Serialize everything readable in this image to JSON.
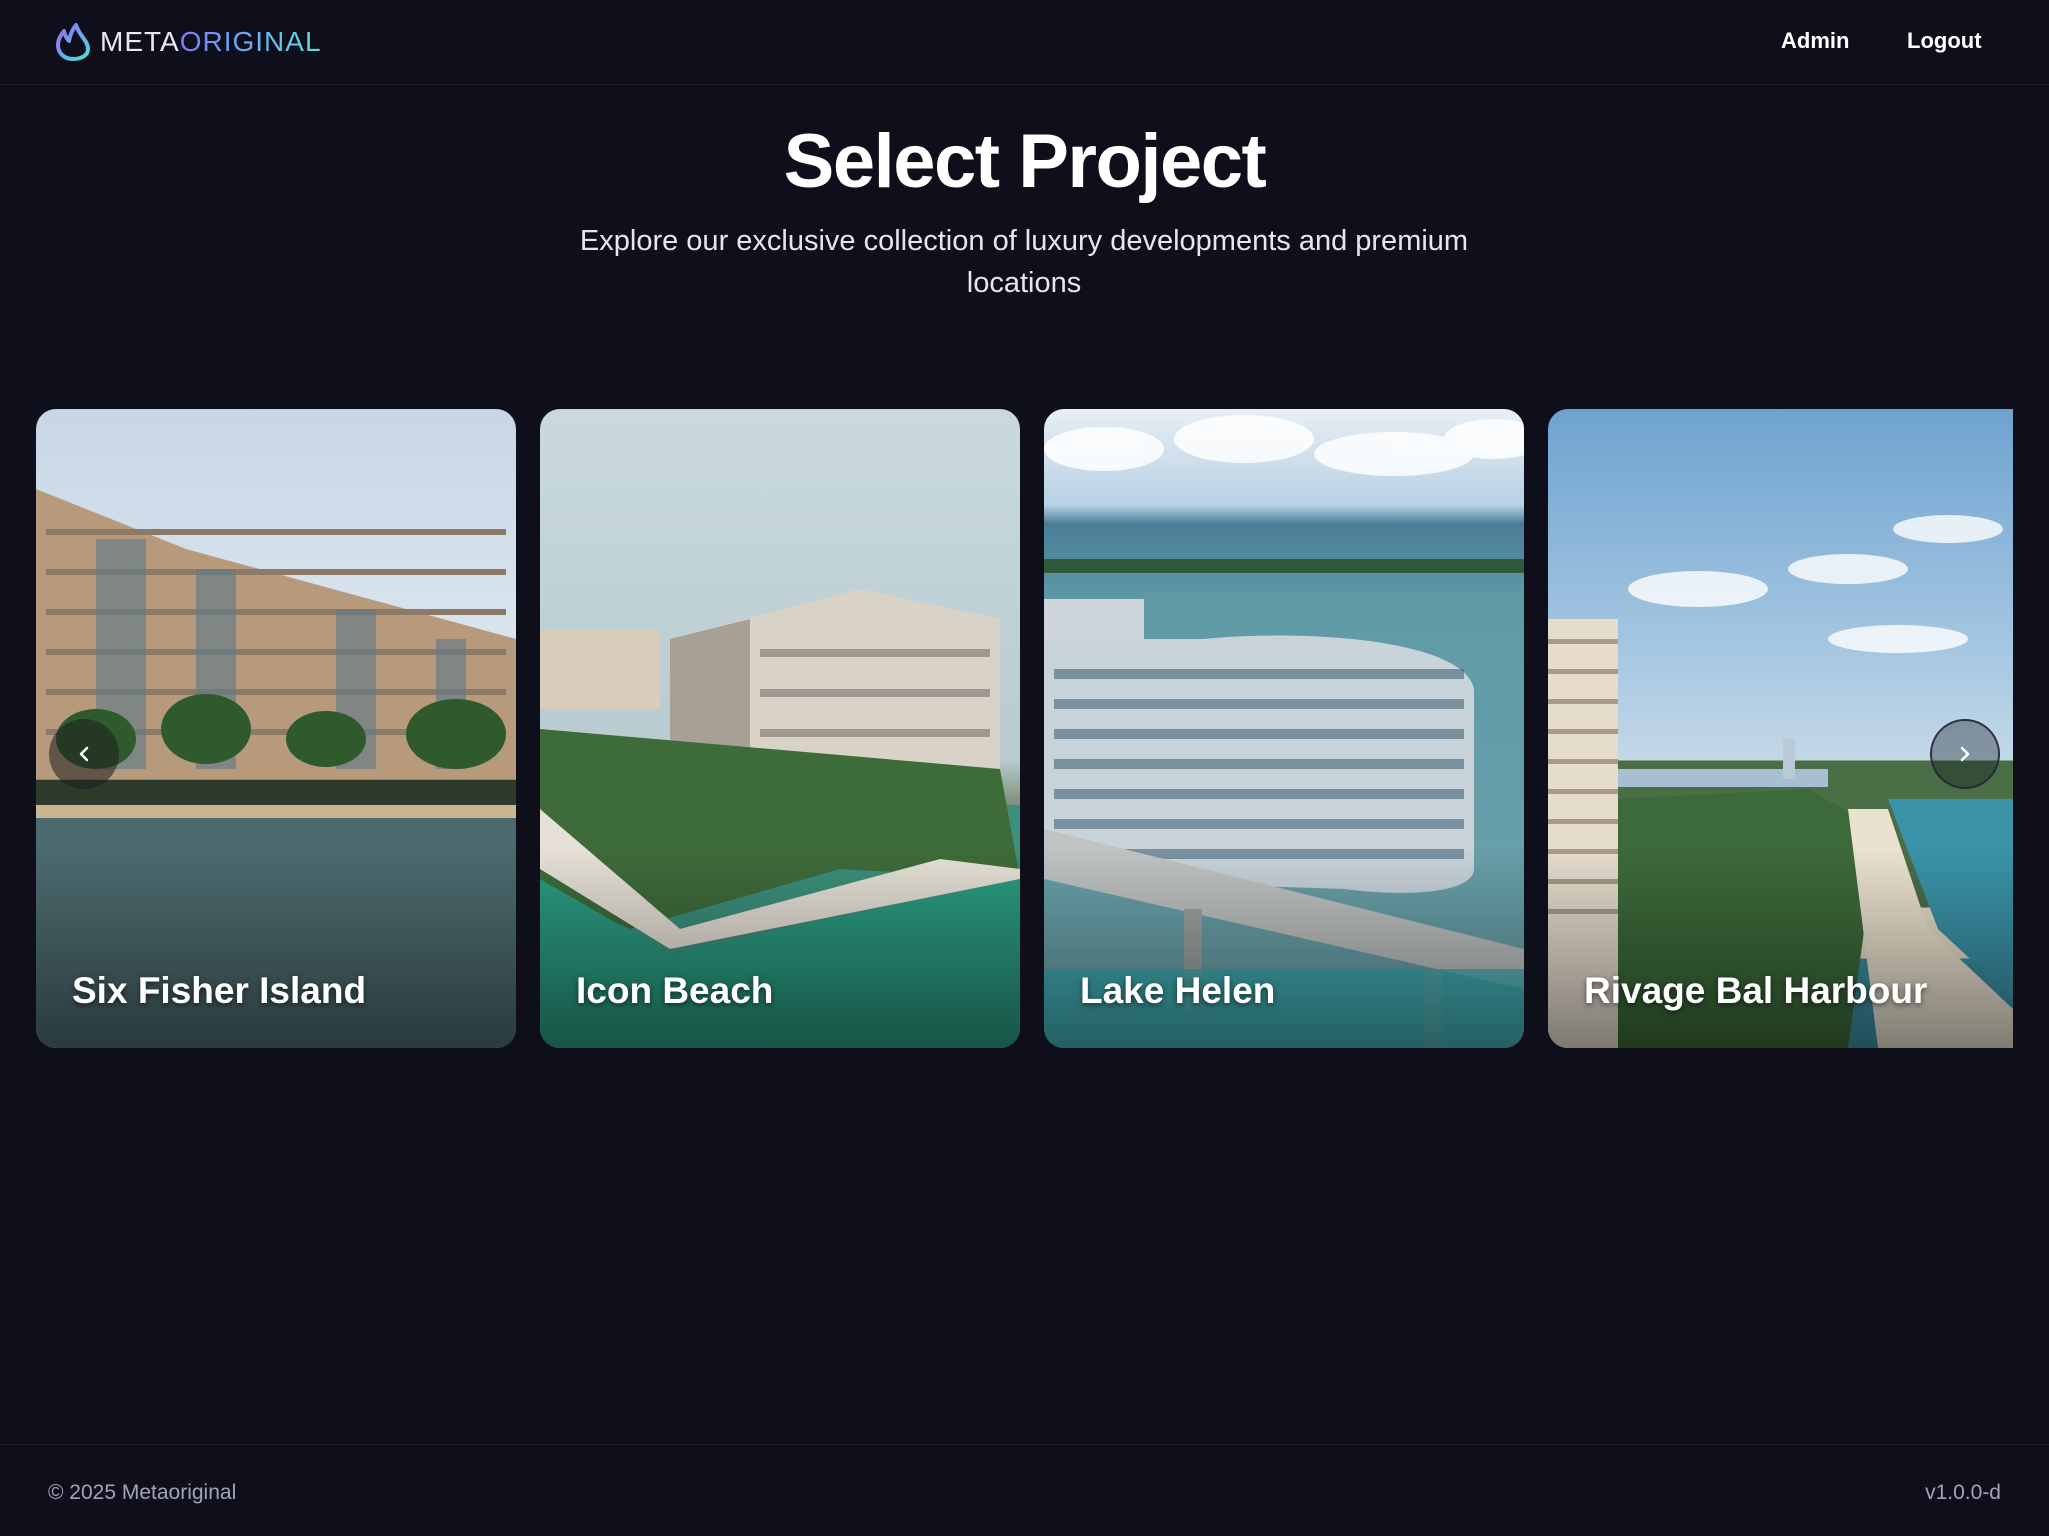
{
  "header": {
    "logo_text_primary": "META",
    "logo_text_accent": "ORIGINAL",
    "nav": {
      "admin": "Admin",
      "logout": "Logout"
    }
  },
  "hero": {
    "title": "Select Project",
    "subtitle": "Explore our exclusive collection of luxury developments and premium locations"
  },
  "carousel": {
    "projects": [
      {
        "name": "Six Fisher Island"
      },
      {
        "name": "Icon Beach"
      },
      {
        "name": "Lake Helen"
      },
      {
        "name": "Rivage Bal Harbour"
      }
    ],
    "prev_icon": "chevron-left-icon",
    "next_icon": "chevron-right-icon"
  },
  "footer": {
    "copyright": "© 2025 Metaoriginal",
    "version": "v1.0.0-d"
  },
  "colors": {
    "background": "#0f0f1b",
    "text": "#ffffff",
    "muted": "#a3a4b3",
    "accent_start": "#7b7df4",
    "accent_end": "#5fe0d6"
  }
}
